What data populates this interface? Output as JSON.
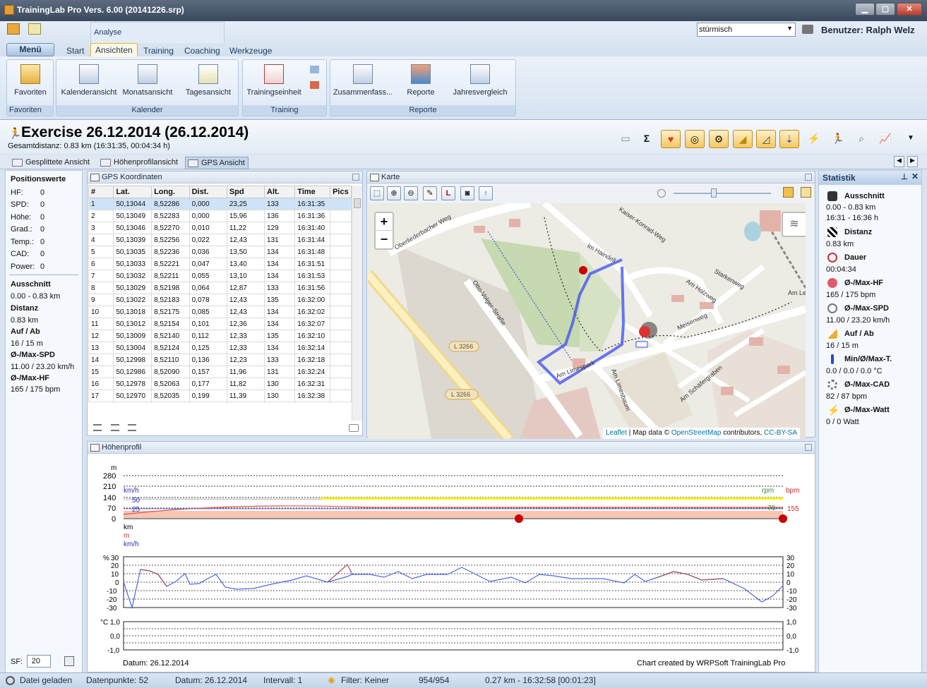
{
  "window": {
    "title": "TrainingLab Pro Vers. 6.00 (20141226.srp)"
  },
  "ribbon": {
    "context_label": "Analyse",
    "menu_button": "Menü",
    "tabs": [
      "Start",
      "Ansichten",
      "Training",
      "Coaching",
      "Werkzeuge"
    ],
    "active_tab": "Ansichten",
    "profile_select": "stürmisch",
    "user": "Benutzer: Ralph Welz",
    "groups": [
      {
        "label": "Favoriten",
        "buttons": [
          "Favoriten"
        ]
      },
      {
        "label": "Kalender",
        "buttons": [
          "Kalenderansicht",
          "Monatsansicht",
          "Tagesansicht"
        ]
      },
      {
        "label": "Training",
        "buttons": [
          "Trainingseinheit"
        ]
      },
      {
        "label": "Reporte",
        "buttons": [
          "Zusammenfass...",
          "Reporte",
          "Jahresvergleich"
        ]
      }
    ]
  },
  "exercise": {
    "title": "Exercise 26.12.2014 (26.12.2014)",
    "subtitle": "Gesamtdistanz: 0.83 km (16:31:35, 00:04:34 h)",
    "toolbar_icons": [
      "image-icon",
      "sigma-icon",
      "heart-icon",
      "speed-icon",
      "cadence-icon",
      "elevation-icon",
      "grade-icon",
      "temperature-icon",
      "power-icon",
      "runner-icon",
      "search-icon",
      "chart-icon",
      "chevron-down-icon"
    ]
  },
  "view_tabs": [
    "Gesplittete Ansicht",
    "Höhenprofilansicht",
    "GPS Ansicht"
  ],
  "active_view": "GPS Ansicht",
  "position": {
    "title": "Positionswerte",
    "rows": [
      {
        "label": "HF:",
        "value": "0"
      },
      {
        "label": "SPD:",
        "value": "0"
      },
      {
        "label": "Höhe:",
        "value": "0"
      },
      {
        "label": "Grad.:",
        "value": "0"
      },
      {
        "label": "Temp.:",
        "value": "0"
      },
      {
        "label": "CAD:",
        "value": "0"
      },
      {
        "label": "Power:",
        "value": "0"
      }
    ],
    "summary": [
      {
        "label": "Ausschnitt",
        "value": "0.00 - 0.83 km"
      },
      {
        "label": "Distanz",
        "value": "0.83 km"
      },
      {
        "label": "Auf / Ab",
        "value": "16 / 15 m"
      },
      {
        "label": "Ø-/Max-SPD",
        "value": "11.00 / 23.20 km/h"
      },
      {
        "label": "Ø-/Max-HF",
        "value": "165 / 175 bpm"
      }
    ],
    "sf_label": "SF:",
    "sf_value": "20"
  },
  "gps": {
    "title": "GPS Koordinaten",
    "columns": [
      "#",
      "Lat.",
      "Long.",
      "Dist.",
      "Spd",
      "Alt.",
      "Time",
      "Pics"
    ],
    "rows": [
      [
        "1",
        "50,13044",
        "8,52286",
        "0,000",
        "23,25",
        "133",
        "16:31:35",
        ""
      ],
      [
        "2",
        "50,13049",
        "8,52283",
        "0,000",
        "15,96",
        "136",
        "16:31:36",
        ""
      ],
      [
        "3",
        "50,13046",
        "8,52270",
        "0,010",
        "11,22",
        "129",
        "16:31:40",
        ""
      ],
      [
        "4",
        "50,13039",
        "8,52256",
        "0,022",
        "12,43",
        "131",
        "16:31:44",
        ""
      ],
      [
        "5",
        "50,13035",
        "8,52236",
        "0,036",
        "13,50",
        "134",
        "16:31:48",
        ""
      ],
      [
        "6",
        "50,13033",
        "8,52221",
        "0,047",
        "13,40",
        "134",
        "16:31:51",
        ""
      ],
      [
        "7",
        "50,13032",
        "8,52211",
        "0,055",
        "13,10",
        "134",
        "16:31:53",
        ""
      ],
      [
        "8",
        "50,13029",
        "8,52198",
        "0,064",
        "12,87",
        "133",
        "16:31:56",
        ""
      ],
      [
        "9",
        "50,13022",
        "8,52183",
        "0,078",
        "12,43",
        "135",
        "16:32:00",
        ""
      ],
      [
        "10",
        "50,13018",
        "8,52175",
        "0,085",
        "12,43",
        "134",
        "16:32:02",
        ""
      ],
      [
        "11",
        "50,13012",
        "8,52154",
        "0,101",
        "12,36",
        "134",
        "16:32:07",
        ""
      ],
      [
        "12",
        "50,13009",
        "8,52140",
        "0,112",
        "12,33",
        "135",
        "16:32:10",
        ""
      ],
      [
        "13",
        "50,13004",
        "8,52124",
        "0,125",
        "12,33",
        "134",
        "16:32:14",
        ""
      ],
      [
        "14",
        "50,12998",
        "8,52110",
        "0,136",
        "12,23",
        "133",
        "16:32:18",
        ""
      ],
      [
        "15",
        "50,12986",
        "8,52090",
        "0,157",
        "11,96",
        "131",
        "16:32:24",
        ""
      ],
      [
        "16",
        "50,12978",
        "8,52063",
        "0,177",
        "11,82",
        "130",
        "16:32:31",
        ""
      ],
      [
        "17",
        "50,12970",
        "8,52035",
        "0,199",
        "11,39",
        "130",
        "16:32:38",
        ""
      ]
    ]
  },
  "map": {
    "title": "Karte",
    "zoom_in": "+",
    "zoom_out": "−",
    "attribution_leaflet": "Leaflet",
    "attribution_mid": " | Map data © ",
    "attribution_osm": "OpenStreetMap",
    "attribution_tail": " contributors, ",
    "attribution_license": "CC-BY-SA",
    "streets": [
      "Oberliederbacher Weg",
      "Otto-Volger-Straße",
      "Im Haindell",
      "Kaiser-Konrad-Weg",
      "Starkenweg",
      "Am Holzweg",
      "Meisenweg",
      "Am Limespark",
      "Am Limesbaum",
      "Am Schäfergraben",
      "L 3266",
      "Am Lerchenfeld"
    ],
    "labels": [
      "L 3266",
      "L 3266"
    ]
  },
  "hoehenprofil": {
    "title": "Höhenprofil",
    "unit_m": "m",
    "y_ticks": [
      "280",
      "210",
      "140",
      "70",
      "0"
    ],
    "left_labels": [
      "km/h",
      "50",
      "25"
    ],
    "right_labels": [
      "rpm",
      "bpm",
      "70",
      "155"
    ],
    "bottom_labels": [
      "km",
      "m",
      "km/h"
    ],
    "grade_unit": "%",
    "grade_ticks": [
      "30",
      "20",
      "10",
      "0",
      "-10",
      "-20",
      "-30"
    ],
    "temp_unit": "°C",
    "temp_ticks": [
      "1,0",
      "0,0",
      "-1,0"
    ],
    "date": "Datum: 26.12.2014",
    "credit": "Chart created by WRPSoft TrainingLab Pro"
  },
  "statistik": {
    "title": "Statistik",
    "items": [
      {
        "label": "Ausschnitt",
        "value": "0.00 - 0.83 km",
        "value2": "16:31 - 16:36 h",
        "icon": "flag-icon"
      },
      {
        "label": "Distanz",
        "value": "0.83 km",
        "icon": "checkered-flag-icon"
      },
      {
        "label": "Dauer",
        "value": "00:04:34",
        "icon": "stopwatch-icon"
      },
      {
        "label": "Ø-/Max-HF",
        "value": "165 / 175 bpm",
        "icon": "heart-icon"
      },
      {
        "label": "Ø-/Max-SPD",
        "value": "11.00 / 23.20 km/h",
        "icon": "speedometer-icon"
      },
      {
        "label": "Auf / Ab",
        "value": "16 / 15 m",
        "icon": "elevation-icon"
      },
      {
        "label": "Min/Ø/Max-T.",
        "value": "0.0 / 0.0 / 0.0 °C",
        "icon": "thermometer-icon"
      },
      {
        "label": "Ø-/Max-CAD",
        "value": "82 / 87 bpm",
        "icon": "gear-icon"
      },
      {
        "label": "Ø-/Max-Watt",
        "value": "0 / 0 Watt",
        "icon": "lightning-icon"
      }
    ]
  },
  "status": {
    "loaded": "Datei geladen",
    "points": "Datenpunkte: 52",
    "date": "Datum: 26.12.2014",
    "interval": "Intervall: 1",
    "filter": "Filter: Keiner",
    "count": "954/954",
    "position": "0.27 km - 16:32:58 [00:01:23]"
  },
  "colors": {
    "accent": "#f5c860",
    "route": "#3a4cf0",
    "heart": "#e05a6a"
  }
}
